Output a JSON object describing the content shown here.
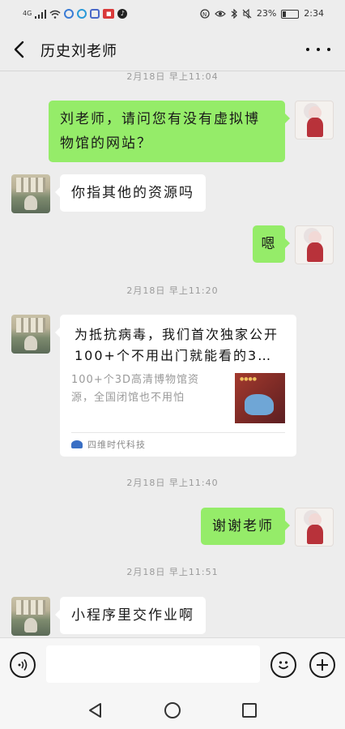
{
  "status_bar": {
    "network": "4G",
    "battery_text": "23%",
    "time": "2:34"
  },
  "header": {
    "title": "历史刘老师",
    "back_icon": "chevron-left-icon",
    "more_icon": "more-dots-icon"
  },
  "messages": [
    {
      "type": "time",
      "text": "2月18日 早上11:04"
    },
    {
      "type": "text",
      "from": "me",
      "text": "刘老师，请问您有没有虚拟博物馆的网站？"
    },
    {
      "type": "text",
      "from": "teacher",
      "text": "你指其他的资源吗"
    },
    {
      "type": "text",
      "from": "me",
      "text": "嗯"
    },
    {
      "type": "time",
      "text": "2月18日 早上11:20"
    },
    {
      "type": "link_card",
      "from": "teacher",
      "title": "为抵抗病毒，我们首次独家公开100+个不用出门就能看的3…",
      "description": "100+个3D高清博物馆资源，全国闭馆也不用怕",
      "source": "四维时代科技"
    },
    {
      "type": "time",
      "text": "2月18日 早上11:40"
    },
    {
      "type": "text",
      "from": "me",
      "text": "谢谢老师"
    },
    {
      "type": "time",
      "text": "2月18日 早上11:51"
    },
    {
      "type": "text",
      "from": "teacher",
      "text": "小程序里交作业啊"
    }
  ],
  "input_bar": {
    "voice_icon": "voice-icon",
    "emoji_icon": "emoji-icon",
    "plus_icon": "plus-icon",
    "placeholder": ""
  },
  "colors": {
    "background": "#ededed",
    "my_bubble": "#95ec69",
    "their_bubble": "#ffffff"
  }
}
